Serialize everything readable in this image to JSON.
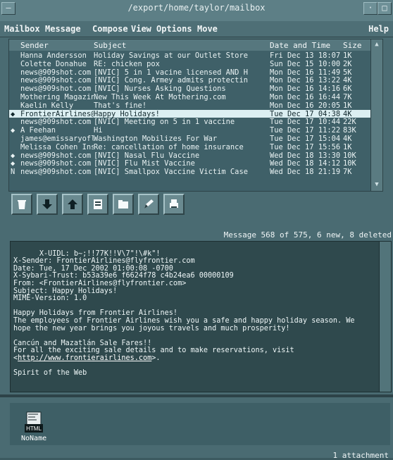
{
  "window": {
    "title": "/export/home/taylor/mailbox",
    "minimize_glyph": "–"
  },
  "menu": {
    "items": [
      "Mailbox",
      "Message",
      "Compose",
      "View",
      "Options",
      "Move"
    ],
    "help": "Help"
  },
  "list": {
    "headers": {
      "sender": "Sender",
      "subject": "Subject",
      "date": "Date and Time",
      "size": "Size"
    },
    "rows": [
      {
        "flag": "",
        "sender": "Hanna Andersson",
        "subject": "Holiday Savings at our Outlet Store",
        "date": "Fri Dec 13 18:07",
        "size": "1K"
      },
      {
        "flag": "",
        "sender": "Colette Donahue",
        "subject": "RE: chicken pox",
        "date": "Sun Dec 15 10:00",
        "size": "2K"
      },
      {
        "flag": "",
        "sender": "news@909shot.com",
        "subject": "[NVIC] 5 in 1 vacine licensed AND H",
        "date": "Mon Dec 16 11:49",
        "size": "5K"
      },
      {
        "flag": "",
        "sender": "news@909shot.com",
        "subject": "[NVIC] Cong. Armey admits protectin",
        "date": "Mon Dec 16 13:22",
        "size": "4K"
      },
      {
        "flag": "",
        "sender": "news@909shot.com",
        "subject": "[NVIC] Nurses Asking Questions",
        "date": "Mon Dec 16 14:16",
        "size": "6K"
      },
      {
        "flag": "",
        "sender": "Mothering Magazine",
        "subject": "New This Week At Mothering.com",
        "date": "Mon Dec 16 16:44",
        "size": "7K"
      },
      {
        "flag": "",
        "sender": "Kaelin Kelly",
        "subject": "That's fine!",
        "date": "Mon Dec 16 20:05",
        "size": "1K"
      },
      {
        "flag": "◆",
        "sender": "FrontierAirlines@f",
        "subject": "Happy Holidays!",
        "date": "Tue Dec 17 04:38",
        "size": "4K",
        "selected": true
      },
      {
        "flag": "",
        "sender": "news@909shot.com",
        "subject": "[NVIC] Meeting on 5 in 1 vaccine",
        "date": "Tue Dec 17 10:44",
        "size": "22K"
      },
      {
        "flag": "◆",
        "sender": "A Feehan",
        "subject": "Hi",
        "date": "Tue Dec 17 11:22",
        "size": "83K"
      },
      {
        "flag": "",
        "sender": "james@emissaryofli",
        "subject": "Washington Mobilizes For War",
        "date": "Tue Dec 17 15:04",
        "size": "4K"
      },
      {
        "flag": "",
        "sender": "Melissa Cohen Insu",
        "subject": "Re: cancellation of home insurance",
        "date": "Tue Dec 17 15:56",
        "size": "1K"
      },
      {
        "flag": "◆",
        "sender": "news@909shot.com",
        "subject": "[NVIC] Nasal Flu Vaccine",
        "date": "Wed Dec 18 13:30",
        "size": "10K"
      },
      {
        "flag": "◆",
        "sender": "news@909shot.com",
        "subject": "[NVIC] Flu Mist Vaccine",
        "date": "Wed Dec 18 14:12",
        "size": "10K"
      },
      {
        "flag": "N",
        "sender": "news@909shot.com",
        "subject": "[NVIC] Smallpox Vaccine Victim Case",
        "date": "Wed Dec 18 21:19",
        "size": "7K"
      }
    ]
  },
  "toolbar": {
    "buttons": [
      "trash-icon",
      "next-message-icon",
      "previous-message-icon",
      "print-pages-icon",
      "save-icon",
      "edit-icon",
      "printer-icon"
    ]
  },
  "status": "Message 568 of 575, 6 new, 8 deleted",
  "message": {
    "text": "X-UIDL: b~;!!77K!!V\\7\"!\\#k\"!\nX-Sender: FrontierAirlines@flyfrontier.com\nDate: Tue, 17 Dec 2002 01:00:08 -0700\nX-Sybari-Trust: b53a39e6 f6624f78 c4b24ea6 00000109\nFrom: <FrontierAirlines@flyfrontier.com>\nSubject: Happy Holidays!\nMIME-Version: 1.0\n\nHappy Holidays from Frontier Airlines!\nThe employees of Frontier Airlines wish you a safe and happy holiday season. We\nhope the new year brings you joyous travels and much prosperity!\n\nCancún and Mazatlán Sale Fares!!\nFor all the exciting sale details and to make reservations, visit\n",
    "link": "http://www.frontierairlines.com",
    "link_open": "<",
    "link_close": ">.",
    "signature": "\n\nSpirit of the Web"
  },
  "attachments": {
    "name": "NoName",
    "icon_label": "HTML",
    "count": "1 attachment"
  }
}
